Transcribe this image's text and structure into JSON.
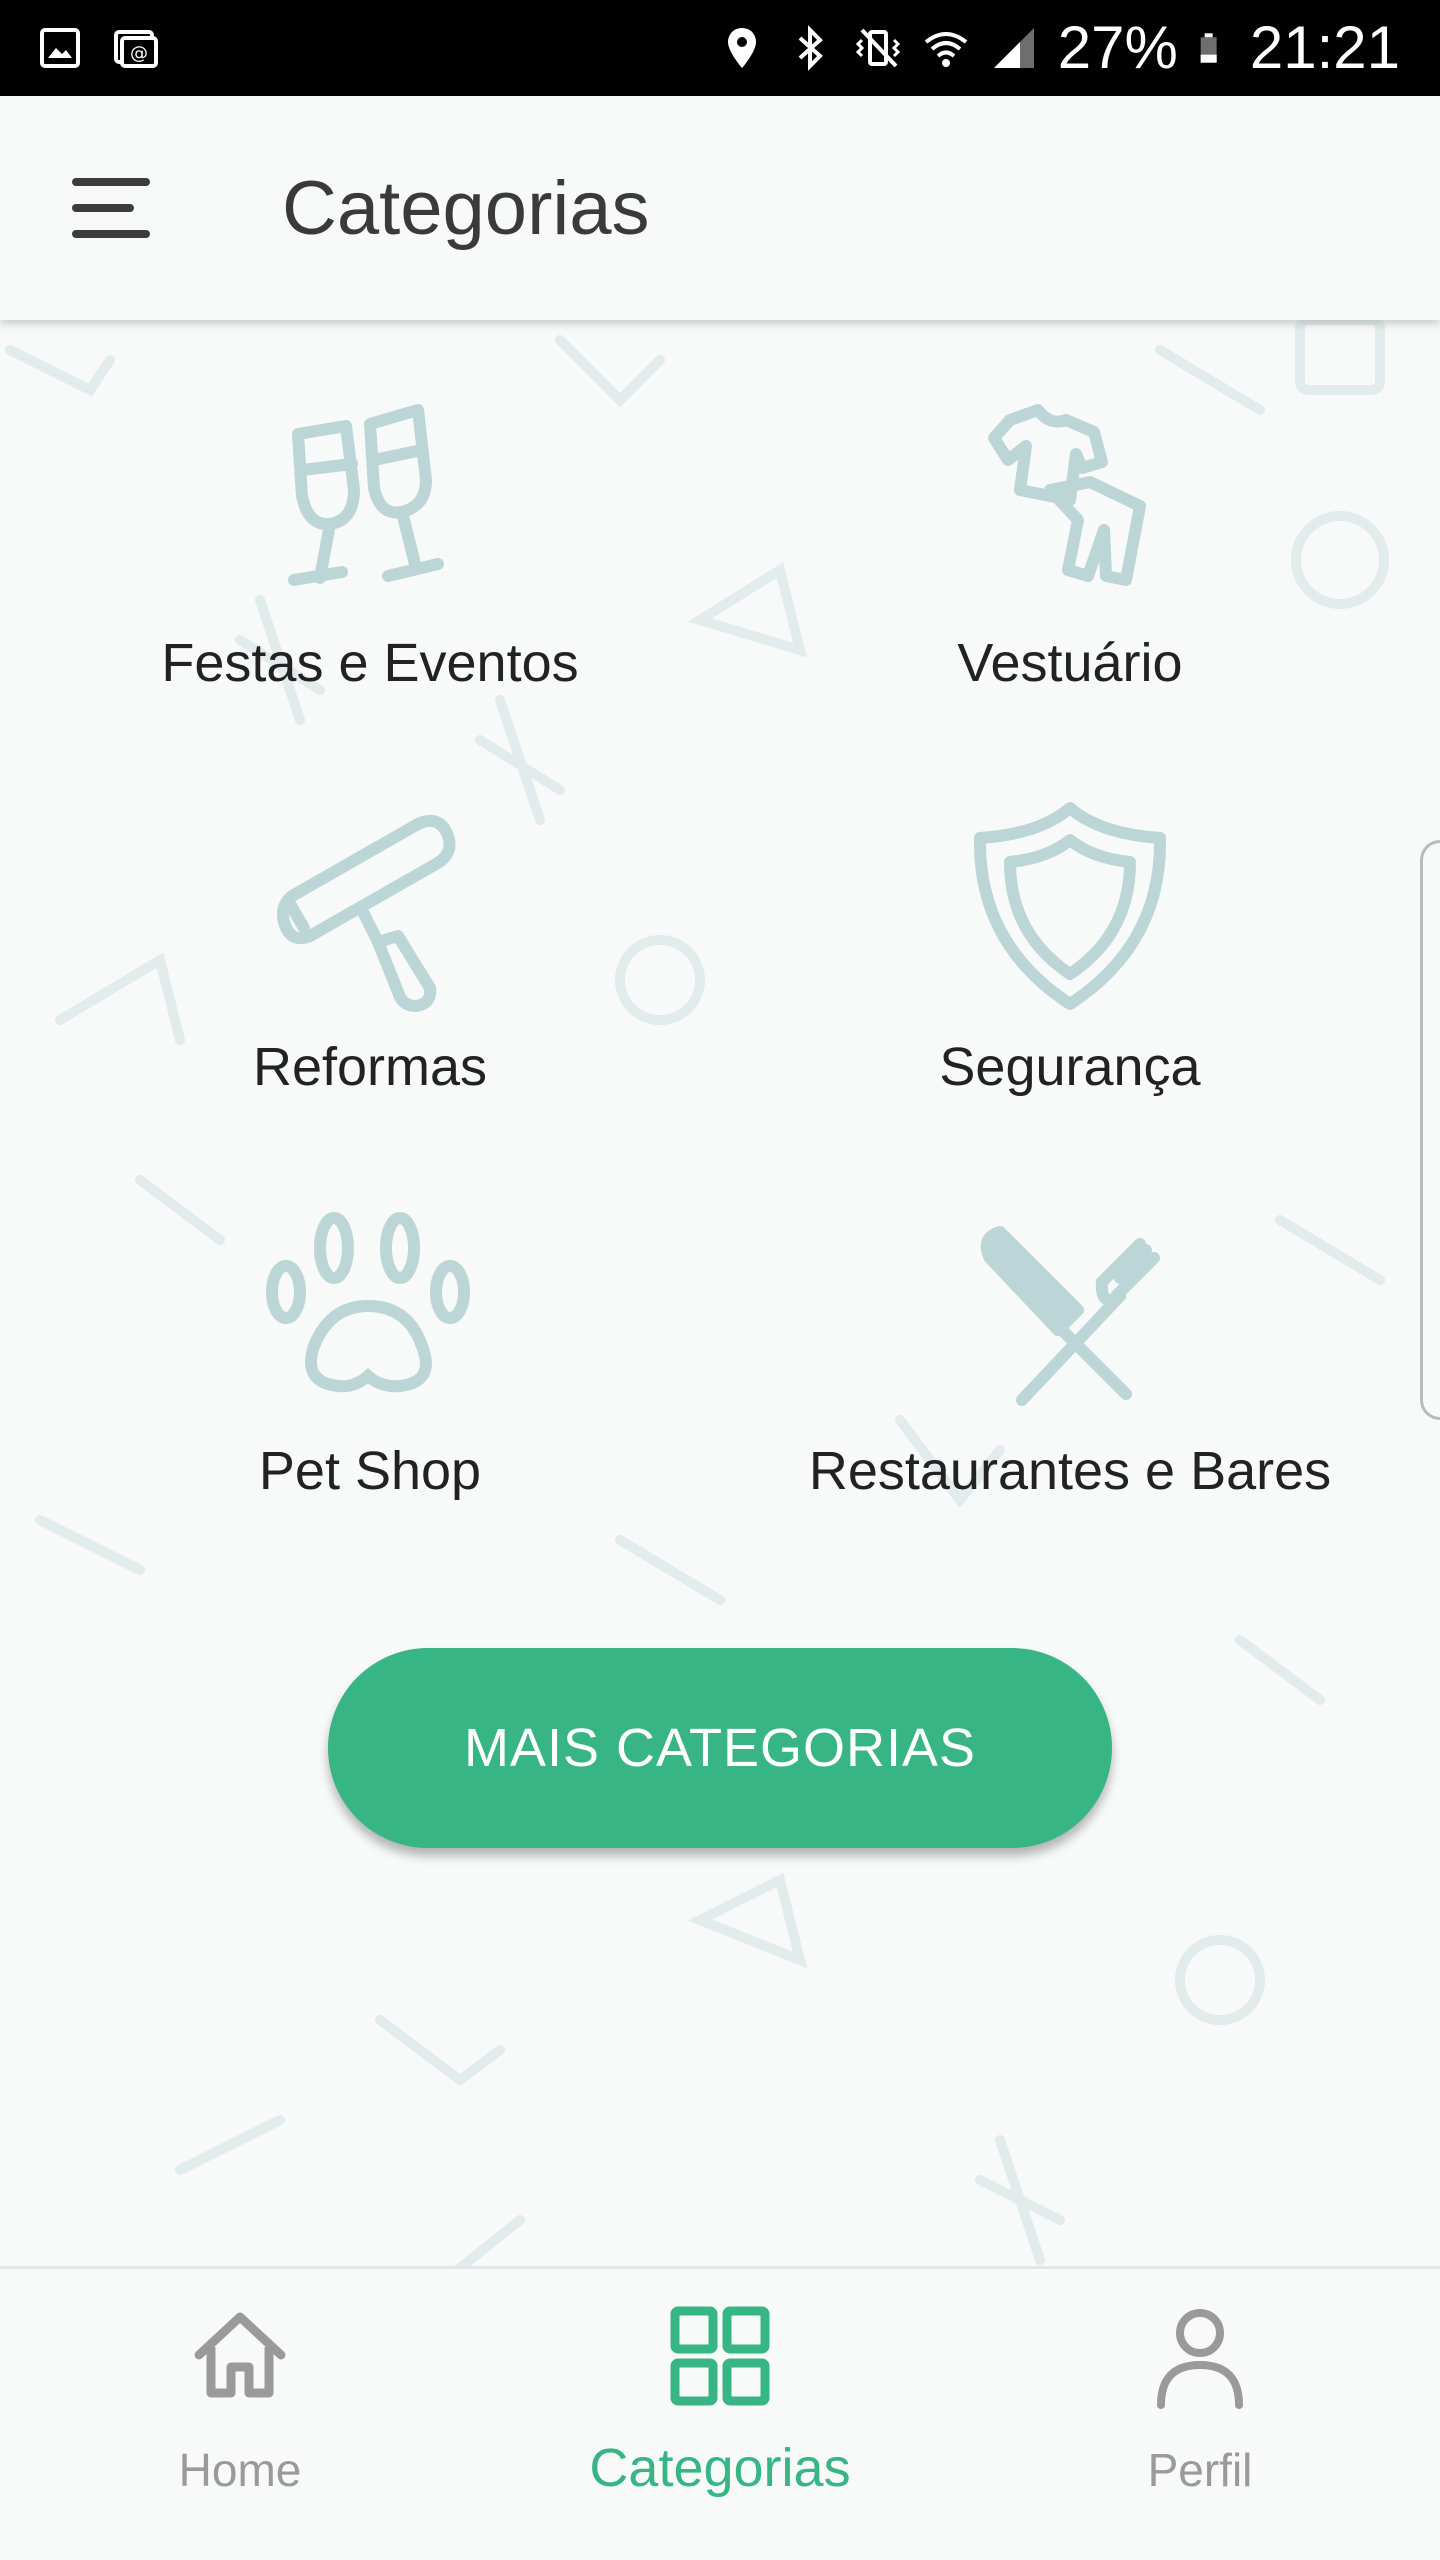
{
  "status_bar": {
    "battery": "27%",
    "time": "21:21",
    "icons": [
      "image-icon",
      "cast-icon",
      "location-icon",
      "bluetooth-icon",
      "vibrate-mute-icon",
      "wifi-icon",
      "signal-icon",
      "battery-icon"
    ]
  },
  "app_bar": {
    "menu_icon": "hamburger-menu-icon",
    "title": "Categorias"
  },
  "categories": [
    {
      "label": "Festas e Eventos",
      "icon": "champagne-glasses-icon"
    },
    {
      "label": "Vestuário",
      "icon": "clothing-icon"
    },
    {
      "label": "Reformas",
      "icon": "paint-roller-icon"
    },
    {
      "label": "Segurança",
      "icon": "shield-icon"
    },
    {
      "label": "Pet Shop",
      "icon": "paw-icon"
    },
    {
      "label": "Restaurantes e Bares",
      "icon": "knife-fork-icon"
    }
  ],
  "more_button": {
    "label": "MAIS CATEGORIAS"
  },
  "bottom_nav": {
    "items": [
      {
        "label": "Home",
        "icon": "home-icon",
        "active": false
      },
      {
        "label": "Categorias",
        "icon": "grid-icon",
        "active": true
      },
      {
        "label": "Perfil",
        "icon": "person-icon",
        "active": false
      }
    ]
  },
  "colors": {
    "accent": "#37b585",
    "icon_tint": "#bcd6d8",
    "text": "#222222",
    "inactive": "#9a9a9a"
  }
}
